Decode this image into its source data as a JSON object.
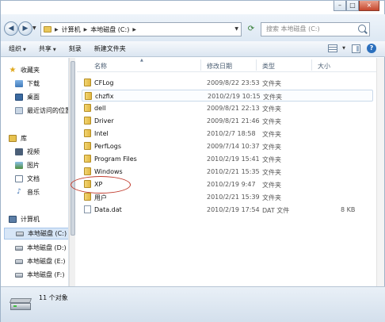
{
  "window": {
    "minimize": "–",
    "maximize": "□",
    "close": "×"
  },
  "address": {
    "breadcrumbs": [
      "计算机",
      "本地磁盘 (C:)"
    ],
    "search_placeholder": "搜索 本地磁盘 (C:)"
  },
  "toolbar": {
    "organize": "组织",
    "share": "共享",
    "burn": "刻录",
    "new_folder": "新建文件夹",
    "help": "?"
  },
  "sidebar": {
    "favorites": "收藏夹",
    "downloads": "下载",
    "desktop": "桌面",
    "recent": "最近访问的位置",
    "libraries": "库",
    "videos": "视频",
    "pictures": "图片",
    "documents": "文档",
    "music": "音乐",
    "computer": "计算机",
    "drive_c": "本地磁盘 (C:)",
    "drive_d": "本地磁盘 (D:)",
    "drive_e": "本地磁盘 (E:)",
    "drive_f": "本地磁盘 (F:)"
  },
  "columns": {
    "name": "名称",
    "modified": "修改日期",
    "type": "类型",
    "size": "大小"
  },
  "files": [
    {
      "name": "CFLog",
      "modified": "2009/8/22 23:53",
      "type": "文件夹",
      "size": "",
      "kind": "folder"
    },
    {
      "name": "chzfix",
      "modified": "2010/2/19 10:15",
      "type": "文件夹",
      "size": "",
      "kind": "folder"
    },
    {
      "name": "dell",
      "modified": "2009/8/21 22:13",
      "type": "文件夹",
      "size": "",
      "kind": "folder"
    },
    {
      "name": "Driver",
      "modified": "2009/8/21 21:46",
      "type": "文件夹",
      "size": "",
      "kind": "folder"
    },
    {
      "name": "Intel",
      "modified": "2010/2/7 18:58",
      "type": "文件夹",
      "size": "",
      "kind": "folder"
    },
    {
      "name": "PerfLogs",
      "modified": "2009/7/14 10:37",
      "type": "文件夹",
      "size": "",
      "kind": "folder"
    },
    {
      "name": "Program Files",
      "modified": "2010/2/19 15:41",
      "type": "文件夹",
      "size": "",
      "kind": "folder"
    },
    {
      "name": "Windows",
      "modified": "2010/2/21 15:35",
      "type": "文件夹",
      "size": "",
      "kind": "folder"
    },
    {
      "name": "XP",
      "modified": "2010/2/19 9:47",
      "type": "文件夹",
      "size": "",
      "kind": "folder"
    },
    {
      "name": "用户",
      "modified": "2010/2/21 15:39",
      "type": "文件夹",
      "size": "",
      "kind": "folder"
    },
    {
      "name": "Data.dat",
      "modified": "2010/2/19 17:54",
      "type": "DAT 文件",
      "size": "8 KB",
      "kind": "file"
    }
  ],
  "status": {
    "item_count": "11 个对象"
  }
}
